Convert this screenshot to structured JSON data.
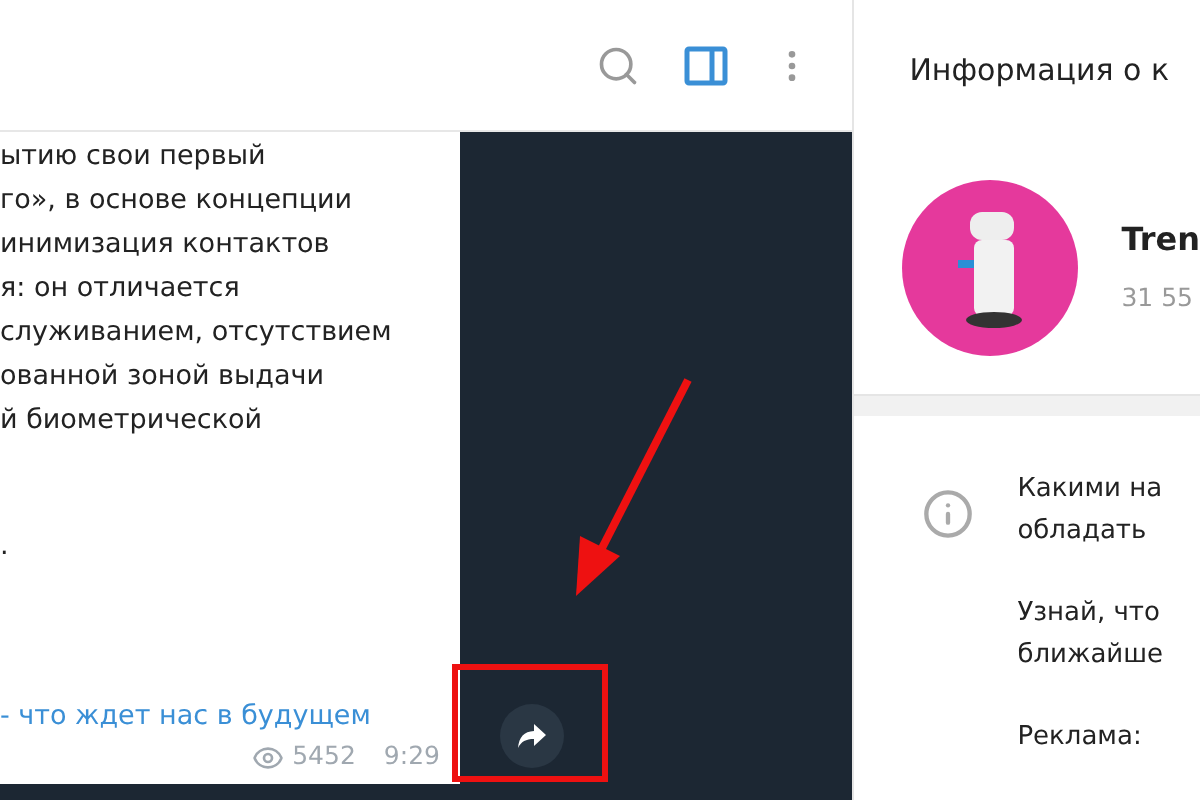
{
  "message": {
    "paragraphs": [
      [
        "ытию свои первый",
        "го», в основе концепции",
        "инимизация контактов",
        "я: он отличается",
        "служиванием, отсутствием",
        "ованной зоной выдачи",
        "й биометрической"
      ],
      [
        "."
      ]
    ],
    "link": "- что ждет нас в будущем",
    "views": "5452",
    "time": "9:29"
  },
  "info_panel": {
    "title": "Информация о к",
    "channel_name": "Tren",
    "subscribers": "31 55",
    "description": [
      [
        "Какими на",
        "обладать"
      ],
      [
        "Узнай, что",
        "ближайше"
      ],
      [
        "Реклама:"
      ]
    ]
  }
}
